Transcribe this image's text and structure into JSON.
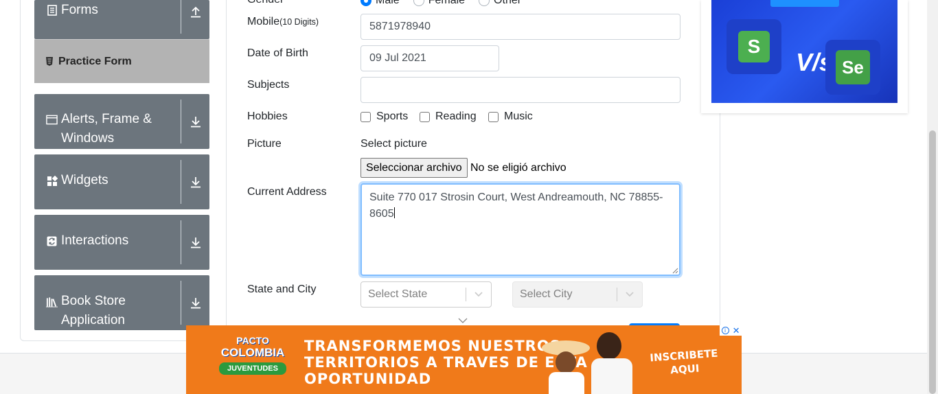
{
  "sidebar": {
    "forms": {
      "title": "Forms",
      "icon": "document-icon"
    },
    "practice_form": {
      "label": "Practice Form",
      "icon": "html5-icon"
    },
    "alerts": {
      "title_line1": "Alerts, Frame &",
      "title_line2": "Windows",
      "icon": "window-icon"
    },
    "widgets": {
      "title": "Widgets",
      "icon": "grid-icon"
    },
    "interactions": {
      "title": "Interactions",
      "icon": "refresh-icon"
    },
    "bookstore": {
      "title_line1": "Book Store",
      "title_line2": "Application",
      "icon": "books-icon"
    }
  },
  "form": {
    "gender": {
      "label": "Gender",
      "options": [
        "Male",
        "Female",
        "Other"
      ],
      "selected": "Male"
    },
    "mobile": {
      "label": "Mobile",
      "hint": "(10 Digits)",
      "value": "5871978940"
    },
    "dob": {
      "label": "Date of Birth",
      "value": "09 Jul 2021"
    },
    "subjects": {
      "label": "Subjects",
      "value": ""
    },
    "hobbies": {
      "label": "Hobbies",
      "options": [
        "Sports",
        "Reading",
        "Music"
      ]
    },
    "picture": {
      "label": "Picture",
      "select_label": "Select picture",
      "button": "Seleccionar archivo",
      "status": "No se eligió archivo"
    },
    "address": {
      "label": "Current Address",
      "line1": "Suite 770 017 Strosin Court, West Andreamouth, NC 78855-",
      "line2": "8605"
    },
    "state_city": {
      "label": "State and City",
      "state_placeholder": "Select State",
      "city_placeholder": "Select City"
    }
  },
  "ads": {
    "right": {
      "vs_text": "V/s",
      "left_logo": "S",
      "right_logo": "Se"
    },
    "bottom": {
      "logo_line1": "PACTO",
      "logo_line2": "COLOMBIA",
      "logo_line3": "JUVENTUDES",
      "headline_line1": "TRANSFORMEMOS NUESTROS",
      "headline_line2": "TERRITORIOS A TRAVES DE ESTA",
      "headline_line3": "OPORTUNIDAD",
      "cta_line1": "INSCRIBETE",
      "cta_line2": "AQUI"
    }
  },
  "colors": {
    "sidebar": "#6c757d",
    "practice_active": "#b3b3b3",
    "accent": "#007bff",
    "ad_orange": "#f07a1a"
  }
}
